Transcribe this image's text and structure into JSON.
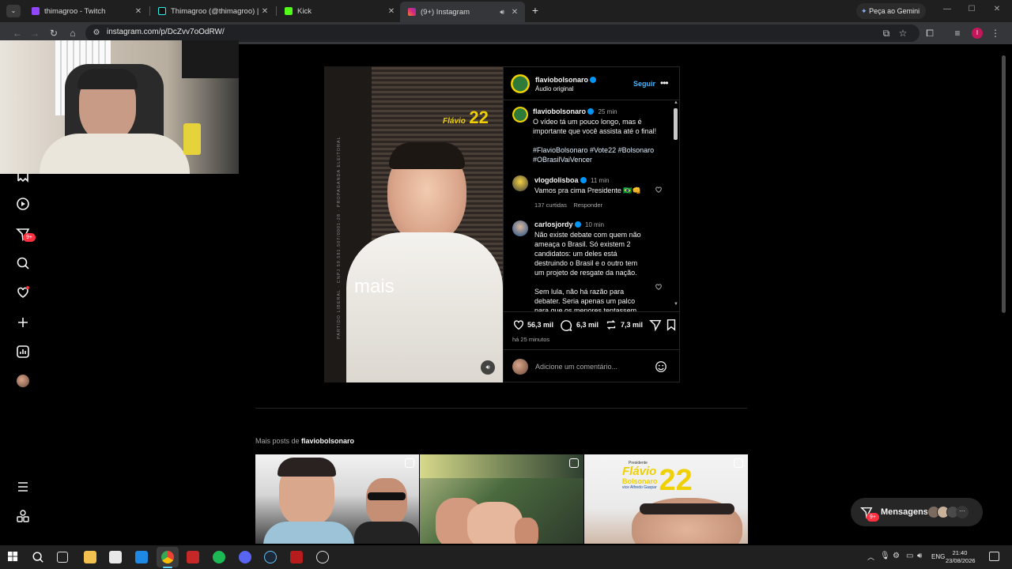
{
  "browser": {
    "tabs": [
      {
        "title": "thimagroo - Twitch",
        "color": "#9146ff"
      },
      {
        "title": "Thimagroo (@thimagroo) | Tik",
        "color": "#111111"
      },
      {
        "title": "Kick",
        "color": "#53fc18"
      },
      {
        "title": "(9+) Instagram",
        "color": "#e1306c"
      }
    ],
    "gemini_label": "Peça ao Gemini",
    "url": "instagram.com/p/DcZvv7oOdRW/",
    "profile_initial": "I"
  },
  "sidebar": {
    "notifications_badge": "9+",
    "icons": [
      "reels-icon",
      "video-icon",
      "messages-icon",
      "search-icon",
      "heart-icon",
      "create-icon",
      "dashboard-icon",
      "profile-avatar",
      "menu-icon",
      "more-apps-icon"
    ]
  },
  "post": {
    "media_overlay_text": "mais",
    "media_logo_name": "Flávio",
    "media_logo_number": "22",
    "media_side_text": "PARTIDO LIBERAL · CNPJ 59.581.507/0001-28 · PROPAGANDA ELEITORAL",
    "author": "flaviobolsonaro",
    "audio": "Áudio original",
    "follow_label": "Seguir",
    "caption_time": "25 min",
    "caption": "O vídeo tá um pouco longo, mas é importante que você assista até o final!",
    "hashtags": "#FlavioBolsonaro #Vote22 #Bolsonaro #OBrasilVaiVencer",
    "comments": [
      {
        "user": "vlogdolisboa",
        "time": "11 min",
        "text": "Vamos pra cima Presidente 🇧🇷👊",
        "likes": "137 curtidas",
        "reply": "Responder"
      },
      {
        "user": "carlosjordy",
        "time": "10 min",
        "text": "Não existe debate com quem não ameaça o Brasil. Só existem 2 candidatos: um deles está destruindo o Brasil e o outro tem um projeto de resgate da nação.",
        "text2": "Sem lula, não há razão para debater. Seria apenas um palco para que os menores tentassem"
      }
    ],
    "likes_count": "56,3 mil",
    "comments_count": "6,3 mil",
    "reposts_count": "7,3 mil",
    "posted_ago": "há 25 minutos",
    "comment_placeholder": "Adicione um comentário..."
  },
  "more_posts": {
    "label_prefix": "Mais posts de",
    "label_user": "flaviobolsonaro",
    "thumb3_logo_small": "Presidente",
    "thumb3_logo_name": "Flávio",
    "thumb3_logo_surname": "Bolsonaro",
    "thumb3_logo_number": "22",
    "thumb3_logo_vice": "vice Alfredo Gaspar"
  },
  "messages": {
    "label": "Mensagens",
    "badge": "9+"
  },
  "taskbar": {
    "lang": "ENG",
    "time": "21:40",
    "date": "23/08/2026"
  }
}
